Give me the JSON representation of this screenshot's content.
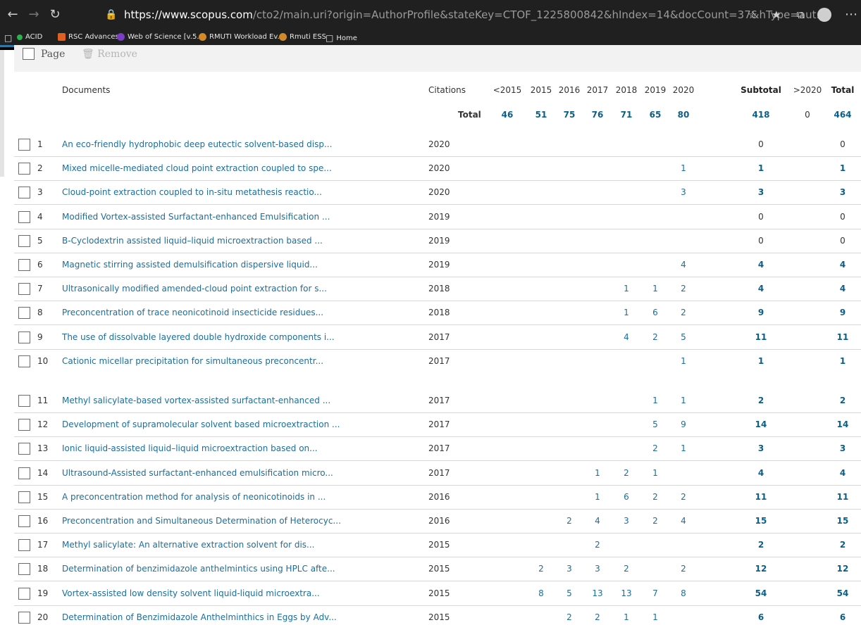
{
  "browser": {
    "url_host": "https://www.scopus.com",
    "url_rest": "/cto2/main.uri?origin=AuthorProfile&stateKey=CTOF_1225800842&hIndex=14&docCount=37&hType=aut...",
    "bookmarks": [
      "ACID",
      "RSC Advances",
      "Web of Science [v.5...",
      "RMUTI Workload Ev...",
      "Rmuti ESS",
      "Home"
    ]
  },
  "toolbar": {
    "page_label": "Page",
    "remove_label": "Remove"
  },
  "table": {
    "headers": [
      "Documents",
      "Citations",
      "<2015",
      "2015",
      "2016",
      "2017",
      "2018",
      "2019",
      "2020",
      "Subtotal",
      ">2020",
      "Total"
    ],
    "total_label": "Total",
    "totals": [
      "46",
      "51",
      "75",
      "76",
      "71",
      "65",
      "80",
      "418",
      "0",
      "464"
    ],
    "rows": [
      {
        "n": "1",
        "title": "An eco-friendly hydrophobic deep eutectic solvent-based disp...",
        "year": "2020",
        "c2015": "",
        "c2016": "",
        "c2017": "",
        "c2018": "",
        "c2019": "",
        "c2020": "",
        "sub": "0",
        "total": "0"
      },
      {
        "n": "2",
        "title": "Mixed micelle-mediated cloud point extraction coupled to spe...",
        "year": "2020",
        "c2015": "",
        "c2016": "",
        "c2017": "",
        "c2018": "",
        "c2019": "",
        "c2020": "1",
        "sub": "1",
        "total": "1"
      },
      {
        "n": "3",
        "title": "Cloud-point extraction coupled to in-situ metathesis reactio...",
        "year": "2020",
        "c2015": "",
        "c2016": "",
        "c2017": "",
        "c2018": "",
        "c2019": "",
        "c2020": "3",
        "sub": "3",
        "total": "3"
      },
      {
        "n": "4",
        "title": "Modified Vortex-assisted Surfactant-enhanced Emulsification ...",
        "year": "2019",
        "c2015": "",
        "c2016": "",
        "c2017": "",
        "c2018": "",
        "c2019": "",
        "c2020": "",
        "sub": "0",
        "total": "0"
      },
      {
        "n": "5",
        "title": "B-Cyclodextrin assisted liquid–liquid microextraction based ...",
        "year": "2019",
        "c2015": "",
        "c2016": "",
        "c2017": "",
        "c2018": "",
        "c2019": "",
        "c2020": "",
        "sub": "0",
        "total": "0"
      },
      {
        "n": "6",
        "title": "Magnetic stirring assisted demulsification dispersive liquid...",
        "year": "2019",
        "c2015": "",
        "c2016": "",
        "c2017": "",
        "c2018": "",
        "c2019": "",
        "c2020": "4",
        "sub": "4",
        "total": "4"
      },
      {
        "n": "7",
        "title": "Ultrasonically modified amended-cloud point extraction for s...",
        "year": "2018",
        "c2015": "",
        "c2016": "",
        "c2017": "",
        "c2018": "1",
        "c2019": "1",
        "c2020": "2",
        "sub": "4",
        "total": "4"
      },
      {
        "n": "8",
        "title": "Preconcentration of trace neonicotinoid insecticide residues...",
        "year": "2018",
        "c2015": "",
        "c2016": "",
        "c2017": "",
        "c2018": "1",
        "c2019": "6",
        "c2020": "2",
        "sub": "9",
        "total": "9"
      },
      {
        "n": "9",
        "title": "The use of dissolvable layered double hydroxide components i...",
        "year": "2017",
        "c2015": "",
        "c2016": "",
        "c2017": "",
        "c2018": "4",
        "c2019": "2",
        "c2020": "5",
        "sub": "11",
        "total": "11"
      },
      {
        "n": "10",
        "title": "Cationic micellar precipitation for simultaneous preconcentr...",
        "year": "2017",
        "c2015": "",
        "c2016": "",
        "c2017": "",
        "c2018": "",
        "c2019": "",
        "c2020": "1",
        "sub": "1",
        "total": "1"
      },
      {
        "n": "11",
        "title": "Methyl salicylate-based vortex-assisted surfactant-enhanced ...",
        "year": "2017",
        "c2015": "",
        "c2016": "",
        "c2017": "",
        "c2018": "",
        "c2019": "1",
        "c2020": "1",
        "sub": "2",
        "total": "2"
      },
      {
        "n": "12",
        "title": "Development of supramolecular solvent based microextraction ...",
        "year": "2017",
        "c2015": "",
        "c2016": "",
        "c2017": "",
        "c2018": "",
        "c2019": "5",
        "c2020": "9",
        "sub": "14",
        "total": "14"
      },
      {
        "n": "13",
        "title": "Ionic liquid-assisted liquid–liquid microextraction based on...",
        "year": "2017",
        "c2015": "",
        "c2016": "",
        "c2017": "",
        "c2018": "",
        "c2019": "2",
        "c2020": "1",
        "sub": "3",
        "total": "3"
      },
      {
        "n": "14",
        "title": "Ultrasound-Assisted surfactant-enhanced emulsification micro...",
        "year": "2017",
        "c2015": "",
        "c2016": "",
        "c2017": "1",
        "c2018": "2",
        "c2019": "1",
        "c2020": "",
        "sub": "4",
        "total": "4"
      },
      {
        "n": "15",
        "title": "A preconcentration method for analysis of neonicotinoids in ...",
        "year": "2016",
        "c2015": "",
        "c2016": "",
        "c2017": "1",
        "c2018": "6",
        "c2019": "2",
        "c2020": "2",
        "sub": "11",
        "total": "11"
      },
      {
        "n": "16",
        "title": "Preconcentration and Simultaneous Determination of Heterocyc...",
        "year": "2016",
        "c2015": "",
        "c2016": "2",
        "c2017": "4",
        "c2018": "3",
        "c2019": "2",
        "c2020": "4",
        "sub": "15",
        "total": "15"
      },
      {
        "n": "17",
        "title": "Methyl salicylate: An alternative extraction solvent for dis...",
        "year": "2015",
        "c2015": "",
        "c2016": "",
        "c2017": "2",
        "c2018": "",
        "c2019": "",
        "c2020": "",
        "sub": "2",
        "total": "2"
      },
      {
        "n": "18",
        "title": "Determination of benzimidazole anthelmintics using HPLC afte...",
        "year": "2015",
        "c2015": "2",
        "c2016": "3",
        "c2017": "3",
        "c2018": "2",
        "c2019": "",
        "c2020": "2",
        "sub": "12",
        "total": "12"
      },
      {
        "n": "19",
        "title": "Vortex-assisted low density solvent liquid-liquid microextra...",
        "year": "2015",
        "c2015": "8",
        "c2016": "5",
        "c2017": "13",
        "c2018": "13",
        "c2019": "7",
        "c2020": "8",
        "sub": "54",
        "total": "54"
      },
      {
        "n": "20",
        "title": "Determination of Benzimidazole Anthelminthics in Eggs by Adv...",
        "year": "2015",
        "c2015": "",
        "c2016": "2",
        "c2017": "2",
        "c2018": "1",
        "c2019": "1",
        "c2020": "",
        "sub": "6",
        "total": "6"
      }
    ]
  }
}
